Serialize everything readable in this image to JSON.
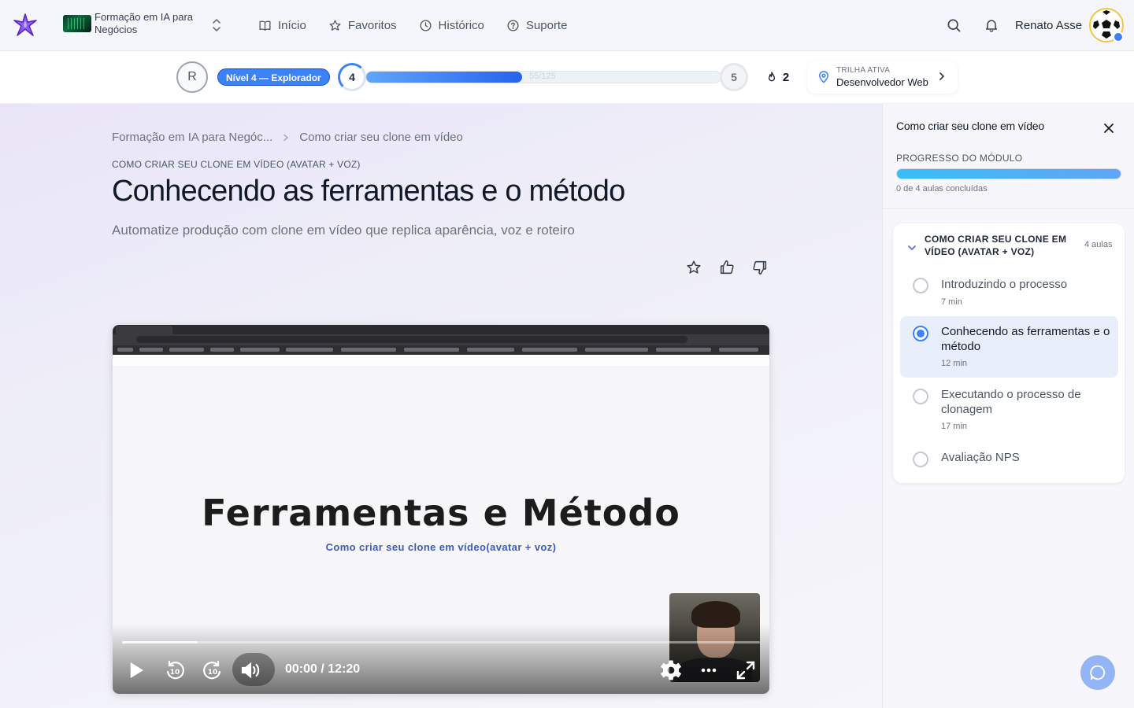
{
  "header": {
    "org_name": "Formação em IA para Negócios",
    "nav": [
      {
        "label": "Início",
        "icon": "book-icon"
      },
      {
        "label": "Favoritos",
        "icon": "star-icon"
      },
      {
        "label": "Histórico",
        "icon": "clock-icon"
      },
      {
        "label": "Suporte",
        "icon": "help-circle-icon"
      }
    ],
    "user_name": "Renato Asse"
  },
  "progress": {
    "user_initial": "R",
    "level_label": "Nível 4 — Explorador",
    "current_level": "4",
    "next_level": "5",
    "xp_text": "55/125",
    "xp_fraction": 0.44,
    "streak": "2",
    "trail_label": "TRILHA ATIVA",
    "trail_value": "Desenvolvedor Web"
  },
  "content": {
    "breadcrumb": [
      "Formação em IA para Negóc...",
      "Como criar seu clone em vídeo"
    ],
    "eyebrow": "COMO CRIAR SEU CLONE EM VÍDEO (AVATAR + VOZ)",
    "title": "Conhecendo as ferramentas e o método",
    "subtitle": "Automatize produção com clone em vídeo que replica aparência, voz e roteiro"
  },
  "video": {
    "slide_title": "Ferramentas e Método",
    "slide_subtitle": "Como criar seu clone em vídeo(avatar + voz)",
    "current_time": "00:00",
    "duration": "/ 12:20",
    "rewind_seconds": "10",
    "forward_seconds": "10"
  },
  "panel": {
    "title": "Como criar seu clone em vídeo",
    "progress_label": "PROGRESSO DO MÓDULO",
    "progress_fraction": 1.0,
    "completed_text": "0 de 4 aulas concluídas",
    "module_title": "COMO CRIAR SEU CLONE EM VÍDEO (AVATAR + VOZ)",
    "lesson_count": "4 aulas",
    "lessons": [
      {
        "name": "Introduzindo o processo",
        "duration": "7 min",
        "active": false
      },
      {
        "name": "Conhecendo as ferramentas e o método",
        "duration": "12 min",
        "active": true
      },
      {
        "name": "Executando o processo de clonagem",
        "duration": "17 min",
        "active": false
      },
      {
        "name": "Avaliação NPS",
        "duration": "",
        "active": false
      }
    ]
  },
  "colors": {
    "accent": "#3b82f6",
    "panel_bg": "#f7f7fb",
    "main_bg": "#ece9f7"
  }
}
